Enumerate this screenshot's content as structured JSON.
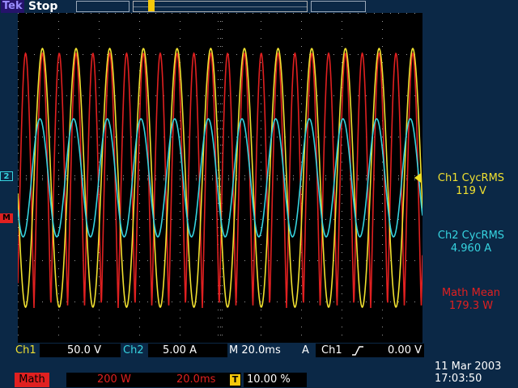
{
  "header": {
    "brand": "Tek",
    "acq_state": "Stop"
  },
  "markers": {
    "trigger_position": "T",
    "ch2_ground": "2",
    "math_ground": "M"
  },
  "measurements": [
    {
      "name": "Ch1 CycRMS",
      "value": "119 V",
      "color": "#f0e030"
    },
    {
      "name": "Ch2 CycRMS",
      "value": "4.960 A",
      "color": "#36d4e0"
    },
    {
      "name": "Math Mean",
      "value": "179.3 W",
      "color": "#e02020"
    }
  ],
  "settings": {
    "ch1_label": "Ch1",
    "ch1_scale": "50.0 V",
    "ch2_label": "Ch2",
    "ch2_scale": "5.00 A",
    "timebase": "M 20.0ms",
    "trigger_mode": "A",
    "trigger_source": "Ch1",
    "trigger_level": "0.00 V",
    "math_label": "Math",
    "math_scale": "200 W",
    "math_time": "20.0ms",
    "trigger_pos_icon": "T",
    "trigger_pos": "10.00 %"
  },
  "datetime": {
    "date": "11 Mar  2003",
    "time": "17:03:50"
  },
  "colors": {
    "ch1": "#f0e030",
    "ch2": "#36d4e0",
    "math": "#e02020",
    "grid": "#9a9a9a",
    "background": "#0b2846"
  }
}
